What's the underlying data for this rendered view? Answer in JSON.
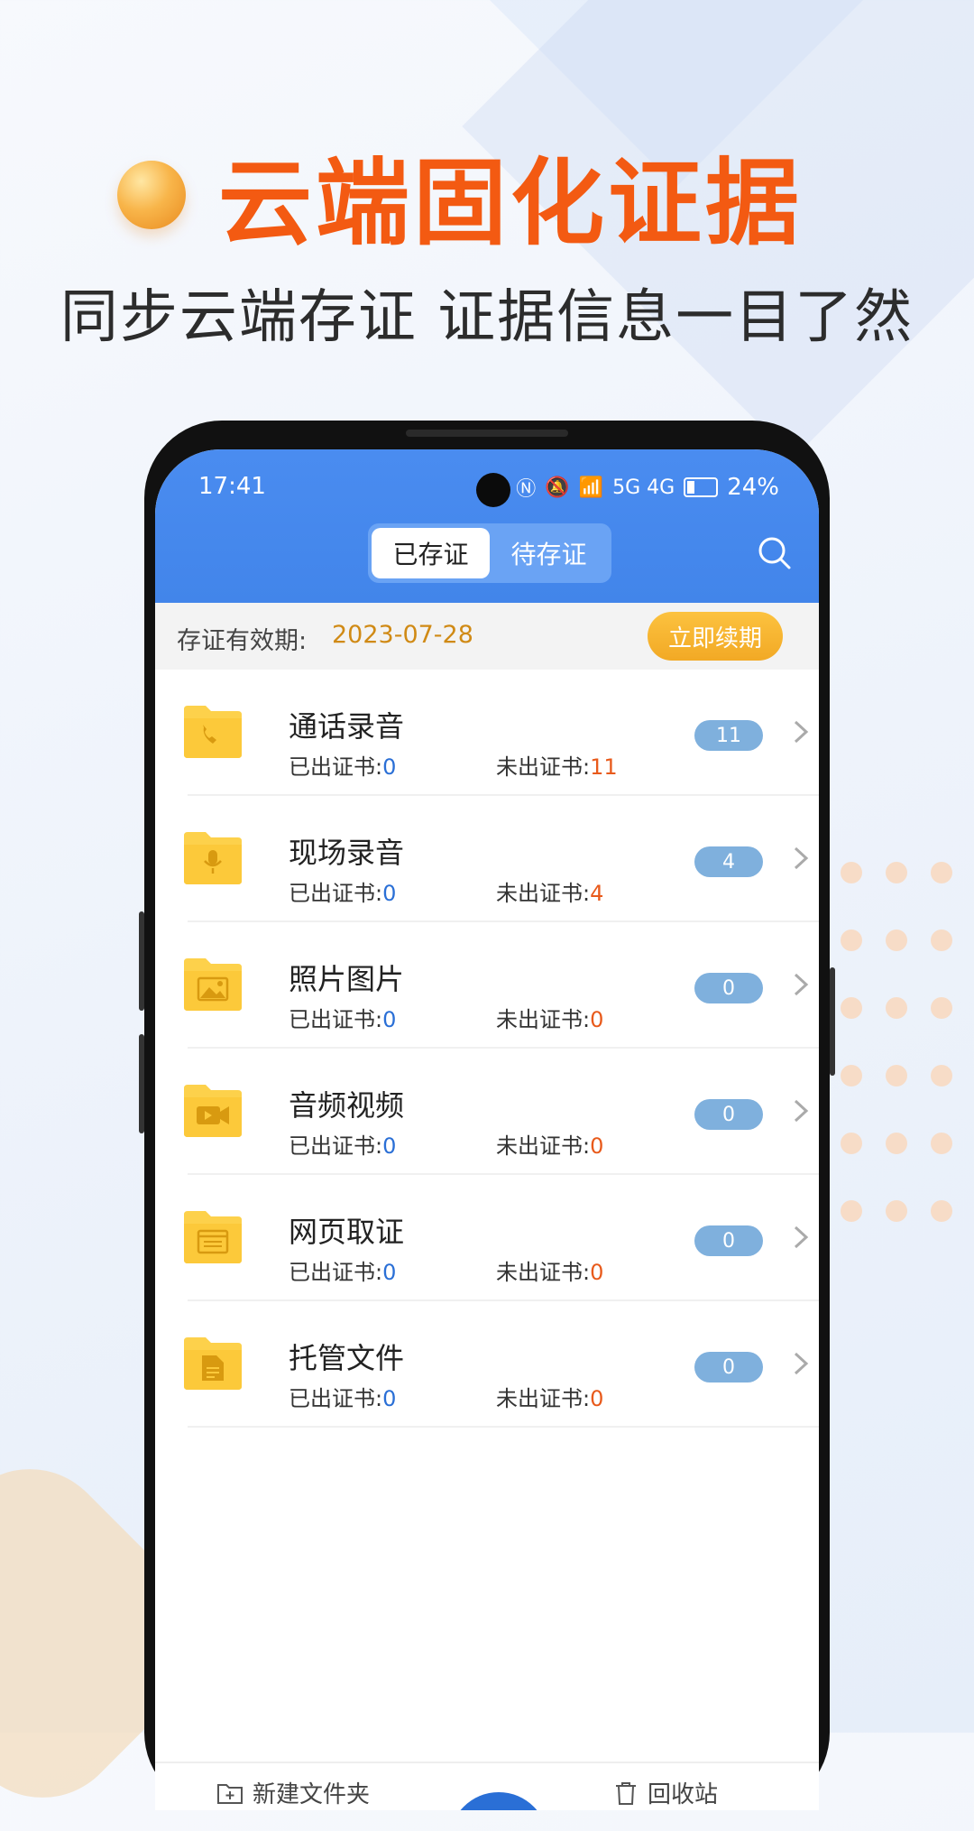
{
  "headline": {
    "title": "云端固化证据",
    "subtitle": "同步云端存证  证据信息一目了然"
  },
  "status_bar": {
    "time": "17:41",
    "network": "5G 4G",
    "battery": "24%"
  },
  "tabs": [
    {
      "label": "已存证",
      "active": true
    },
    {
      "label": "待存证",
      "active": false
    }
  ],
  "validity": {
    "label": "存证有效期:",
    "date": "2023-07-28",
    "renew_label": "立即续期"
  },
  "issued_label": "已出证书:",
  "pending_label": "未出证书:",
  "folders": [
    {
      "name": "通话录音",
      "issued": "0",
      "pending": "11",
      "count": "11",
      "icon": "phone-icon"
    },
    {
      "name": "现场录音",
      "issued": "0",
      "pending": "4",
      "count": "4",
      "icon": "microphone-icon"
    },
    {
      "name": "照片图片",
      "issued": "0",
      "pending": "0",
      "count": "0",
      "icon": "image-icon"
    },
    {
      "name": "音频视频",
      "issued": "0",
      "pending": "0",
      "count": "0",
      "icon": "video-icon"
    },
    {
      "name": "网页取证",
      "issued": "0",
      "pending": "0",
      "count": "0",
      "icon": "webpage-icon"
    },
    {
      "name": "托管文件",
      "issued": "0",
      "pending": "0",
      "count": "0",
      "icon": "document-icon"
    }
  ],
  "bottom_bar": {
    "new_folder": "新建文件夹",
    "recycle_bin": "回收站"
  },
  "colors": {
    "accent_orange": "#f35a12",
    "app_blue": "#4285ea",
    "folder_yellow": "#fdd14b",
    "badge_blue": "#7fb0dd"
  }
}
